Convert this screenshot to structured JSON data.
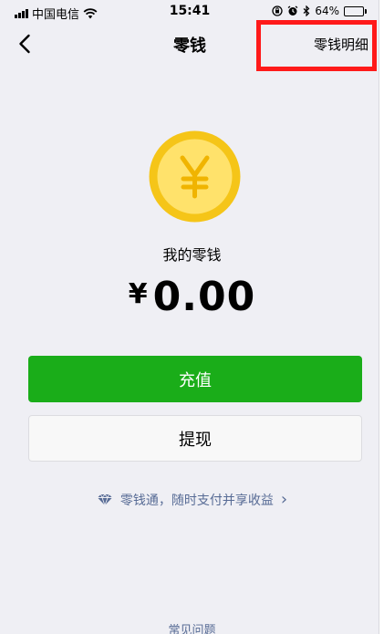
{
  "status_bar": {
    "carrier": "中国电信",
    "time": "15:41",
    "battery_percent": "64%",
    "battery_level": 0.64
  },
  "nav": {
    "title": "零钱",
    "detail_link": "零钱明细"
  },
  "balance": {
    "label": "我的零钱",
    "currency": "¥",
    "amount": "0.00"
  },
  "buttons": {
    "recharge": "充值",
    "withdraw": "提现"
  },
  "promo": {
    "text": "零钱通，随时支付并享收益",
    "arrow": "›"
  },
  "footer": {
    "faq": "常见问题"
  },
  "colors": {
    "primary_green": "#1aad19",
    "link_blue": "#576b95",
    "coin_outer": "#f5c518",
    "coin_inner": "#ffe26b",
    "highlight_red": "#ff1a1a"
  },
  "icons": {
    "coin": "yen-coin-icon",
    "back": "chevron-left-icon",
    "promo": "diamond-icon"
  }
}
